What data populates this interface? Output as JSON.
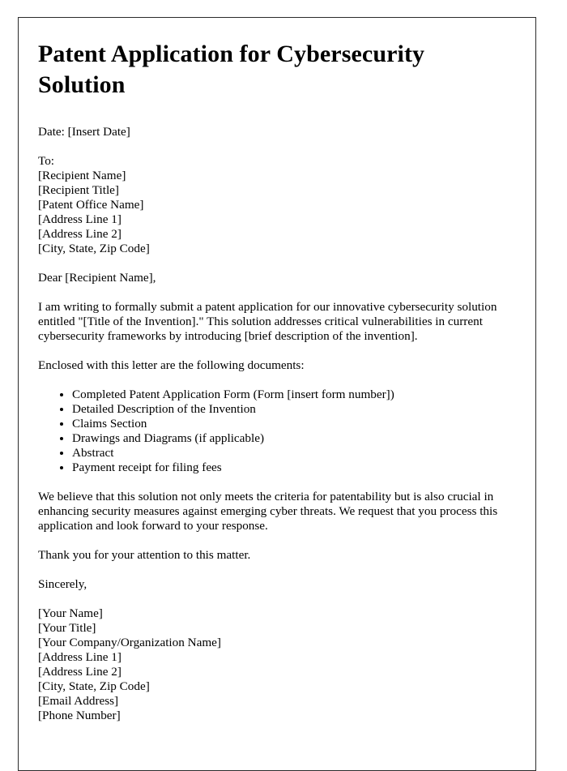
{
  "document": {
    "title": "Patent Application for Cybersecurity Solution",
    "date_line": "Date: [Insert Date]",
    "recipient_heading": "To:",
    "recipient_lines": [
      "[Recipient Name]",
      "[Recipient Title]",
      "[Patent Office Name]",
      "[Address Line 1]",
      "[Address Line 2]",
      "[City, State, Zip Code]"
    ],
    "salutation": "Dear [Recipient Name],",
    "opening_paragraph": "I am writing to formally submit a patent application for our innovative cybersecurity solution entitled \"[Title of the Invention].\" This solution addresses critical vulnerabilities in current cybersecurity frameworks by introducing [brief description of the invention].",
    "enclosure_intro": "Enclosed with this letter are the following documents:",
    "enclosure_items": [
      "Completed Patent Application Form (Form [insert form number])",
      "Detailed Description of the Invention",
      "Claims Section",
      "Drawings and Diagrams (if applicable)",
      "Abstract",
      "Payment receipt for filing fees"
    ],
    "closing_paragraph": "We believe that this solution not only meets the criteria for patentability but is also crucial in enhancing security measures against emerging cyber threats. We request that you process this application and look forward to your response.",
    "thanks_paragraph": "Thank you for your attention to this matter.",
    "sign_off": "Sincerely,",
    "signature_lines": [
      "[Your Name]",
      "[Your Title]",
      "[Your Company/Organization Name]",
      "[Address Line 1]",
      "[Address Line 2]",
      "[City, State, Zip Code]",
      "[Email Address]",
      "[Phone Number]"
    ]
  }
}
